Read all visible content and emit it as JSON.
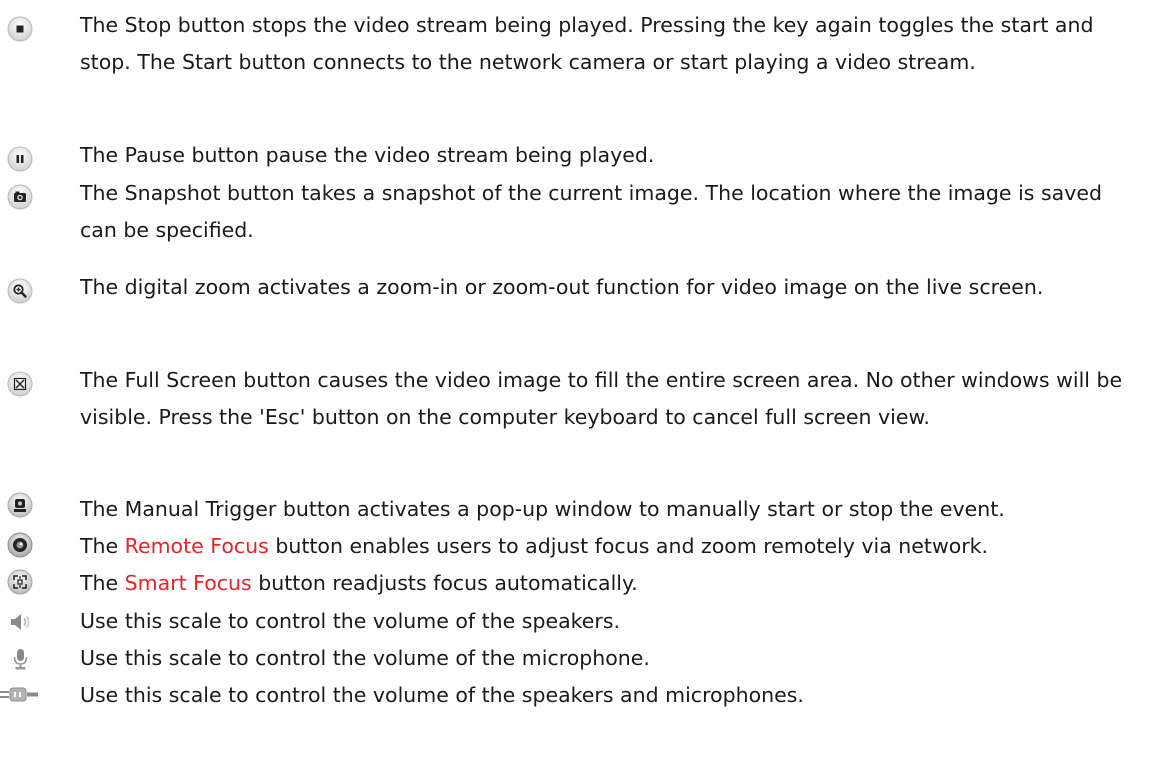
{
  "items": [
    {
      "icon": "stop-button-icon",
      "text": "The Stop button stops the video stream being played. Pressing the key again toggles the start and stop. The Start button connects to the network camera or start playing a video stream."
    },
    {
      "icon": "pause-button-icon",
      "text": "The Pause button pause the video stream being played."
    },
    {
      "icon": "snapshot-button-icon",
      "text": "The Snapshot button takes a snapshot of the current image. The location where the image is saved can be specified."
    },
    {
      "icon": "digital-zoom-icon",
      "text": "The digital zoom activates a zoom-in or zoom-out function for video image on the live screen."
    },
    {
      "icon": "full-screen-icon",
      "text": "The Full Screen button causes the video image to fill the entire screen area. No other windows will be visible. Press the 'Esc' button on the computer keyboard to cancel full screen view."
    },
    {
      "icon": "manual-trigger-icon",
      "text": "The Manual Trigger button activates a pop-up window to manually start or stop the event."
    },
    {
      "icon": "remote-focus-icon",
      "prefix": "The ",
      "highlight": "Remote Focus",
      "suffix": " button enables users to adjust focus and zoom remotely via network."
    },
    {
      "icon": "smart-focus-icon",
      "prefix": "The ",
      "highlight": "Smart Focus",
      "suffix": " button readjusts focus automatically."
    },
    {
      "icon": "speaker-volume-icon",
      "text": "Use this scale to control the volume of the speakers."
    },
    {
      "icon": "microphone-volume-icon",
      "text": "Use this scale to control the volume of the microphone."
    },
    {
      "icon": "speaker-microphone-volume-icon",
      "text": "Use this scale to control the volume of the speakers and microphones."
    }
  ],
  "colors": {
    "highlight": "#e8232a",
    "text": "#1a1a1a",
    "icon_gray": "#8a8a8a",
    "icon_dark": "#222222"
  }
}
